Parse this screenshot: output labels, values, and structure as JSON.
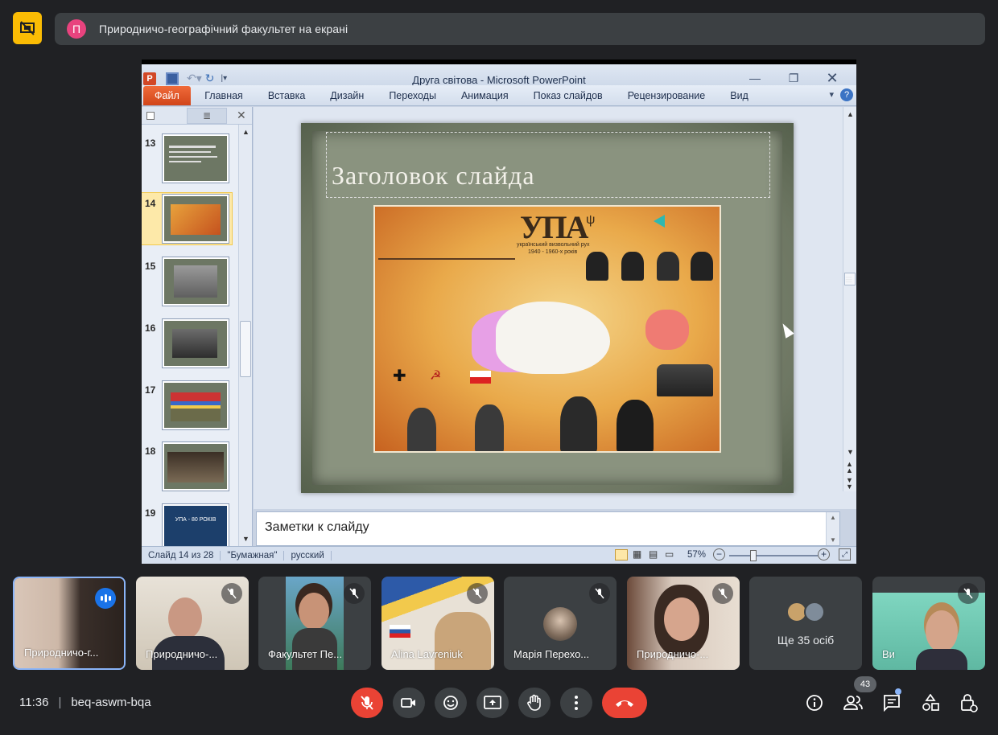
{
  "banner": {
    "avatar_letter": "П",
    "text": "Природничо-географічний факультет на екрані"
  },
  "powerpoint": {
    "window_title": "Друга світова  -  Microsoft PowerPoint",
    "ribbon_tabs": [
      "Файл",
      "Главная",
      "Вставка",
      "Дизайн",
      "Переходы",
      "Анимация",
      "Показ слайдов",
      "Рецензирование",
      "Вид"
    ],
    "slide_numbers": [
      "13",
      "14",
      "15",
      "16",
      "17",
      "18",
      "19"
    ],
    "selected_slide": "14",
    "slide_title": "Заголовок слайда",
    "infographic_heading": "УПА",
    "infographic_subheading": "український визвольний рух",
    "infographic_years": "1940 - 1960-х років",
    "thumb19_text": "УПА - 80 РОКІВ",
    "notes_placeholder": "Заметки к слайду",
    "status": {
      "slide_counter": "Слайд 14 из 28",
      "theme": "\"Бумажная\"",
      "language": "русский",
      "zoom": "57%"
    }
  },
  "participants": [
    {
      "name": "Природничо-г...",
      "speaking": true,
      "muted": false
    },
    {
      "name": "Природничо-...",
      "muted": true
    },
    {
      "name": "Факультет Пе...",
      "muted": true
    },
    {
      "name": "Alina Lavreniuk",
      "muted": true
    },
    {
      "name": "Марія Перехо...",
      "muted": true
    },
    {
      "name": "Природничо-...",
      "muted": true
    },
    {
      "name": "Ще 35 осіб",
      "muted": false
    },
    {
      "name": "Ви",
      "muted": true
    }
  ],
  "bottom_bar": {
    "time": "11:36",
    "separator": "|",
    "meeting_code": "beq-aswm-bqa",
    "participants_count": "43"
  },
  "colors": {
    "end_call": "#ea4335",
    "mic_off": "#ea4335",
    "banner_avatar": "#e8437e",
    "present_icon": "#fbbc04",
    "speaking_border": "#8ab4f8"
  }
}
